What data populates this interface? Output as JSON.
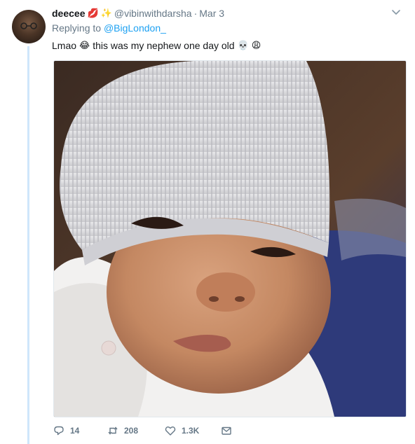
{
  "tweet": {
    "author_name": "deecee",
    "name_emojis": [
      "💋",
      "✨"
    ],
    "handle": "@vibinwithdarsha",
    "separator": "·",
    "date": "Mar 3",
    "replying_prefix": "Replying to",
    "replying_to": "@BigLondon_",
    "text_part1": "Lmao",
    "emoji_laugh": "😂",
    "text_part2": "this was my nephew one day old",
    "emoji_skull": "💀",
    "emoji_weary": "😩"
  },
  "actions": {
    "replies": "14",
    "retweets": "208",
    "likes": "1.3K"
  },
  "icons": {
    "menu": "chevron-down-icon",
    "reply": "reply-icon",
    "retweet": "retweet-icon",
    "like": "heart-icon",
    "dm": "envelope-icon"
  },
  "colors": {
    "link": "#1da1f2",
    "muted": "#657786",
    "thread_line": "#cfe6fb"
  }
}
